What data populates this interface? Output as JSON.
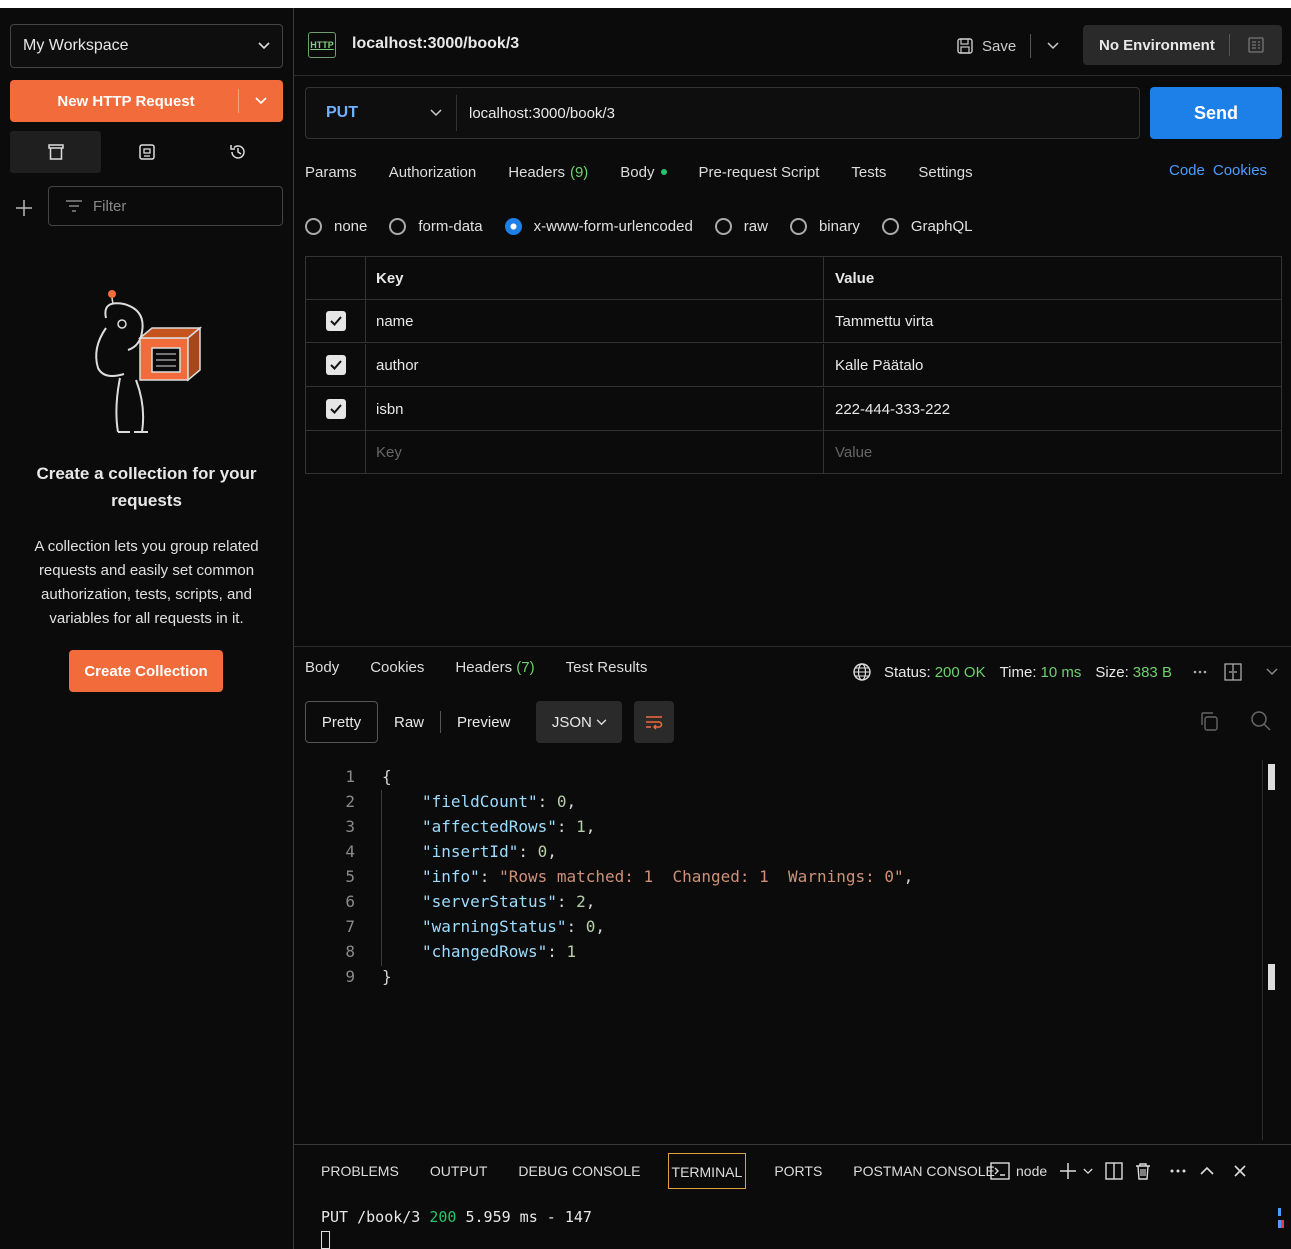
{
  "sidebar": {
    "workspace": "My Workspace",
    "new_request": "New HTTP Request",
    "filter_placeholder": "Filter",
    "empty_title": "Create a collection for your requests",
    "empty_desc": "A collection lets you group related requests and easily set common authorization, tests, scripts, and variables for all requests in it.",
    "create_collection": "Create Collection"
  },
  "tab": {
    "badge": "HTTP",
    "title": "localhost:3000/book/3",
    "save": "Save",
    "environment": "No Environment"
  },
  "request": {
    "method": "PUT",
    "url": "localhost:3000/book/3",
    "send": "Send",
    "tabs": {
      "params": "Params",
      "authorization": "Authorization",
      "headers": "Headers",
      "headers_count": "(9)",
      "body": "Body",
      "prerequest": "Pre-request Script",
      "tests": "Tests",
      "settings": "Settings"
    },
    "code": "Code",
    "cookies": "Cookies",
    "body_types": [
      "none",
      "form-data",
      "x-www-form-urlencoded",
      "raw",
      "binary",
      "GraphQL"
    ],
    "selected_body_type": "x-www-form-urlencoded",
    "kv": {
      "key_header": "Key",
      "value_header": "Value",
      "rows": [
        {
          "key": "name",
          "value": "Tammettu virta"
        },
        {
          "key": "author",
          "value": "Kalle Päätalo"
        },
        {
          "key": "isbn",
          "value": "222-444-333-222"
        }
      ],
      "key_placeholder": "Key",
      "value_placeholder": "Value"
    }
  },
  "response": {
    "tabs": {
      "body": "Body",
      "cookies": "Cookies",
      "headers": "Headers",
      "headers_count": "(7)",
      "test_results": "Test Results"
    },
    "status_label": "Status:",
    "status": "200 OK",
    "time_label": "Time:",
    "time": "10 ms",
    "size_label": "Size:",
    "size": "383 B",
    "views": {
      "pretty": "Pretty",
      "raw": "Raw",
      "preview": "Preview",
      "format": "JSON"
    },
    "lines": {
      "l1": "{",
      "l2k": "\"fieldCount\"",
      "l2v": "0",
      "l3k": "\"affectedRows\"",
      "l3v": "1",
      "l4k": "\"insertId\"",
      "l4v": "0",
      "l5k": "\"info\"",
      "l5v": "\"Rows matched: 1  Changed: 1  Warnings: 0\"",
      "l6k": "\"serverStatus\"",
      "l6v": "2",
      "l7k": "\"warningStatus\"",
      "l7v": "0",
      "l8k": "\"changedRows\"",
      "l8v": "1",
      "l9": "}"
    }
  },
  "terminal": {
    "tabs": {
      "problems": "PROBLEMS",
      "output": "OUTPUT",
      "debug": "DEBUG CONSOLE",
      "terminal": "TERMINAL",
      "ports": "PORTS",
      "postman": "POSTMAN CONSOLE"
    },
    "shell": "node",
    "out_prefix": "PUT /book/3 ",
    "out_status": "200",
    "out_suffix": " 5.959 ms - 147"
  }
}
